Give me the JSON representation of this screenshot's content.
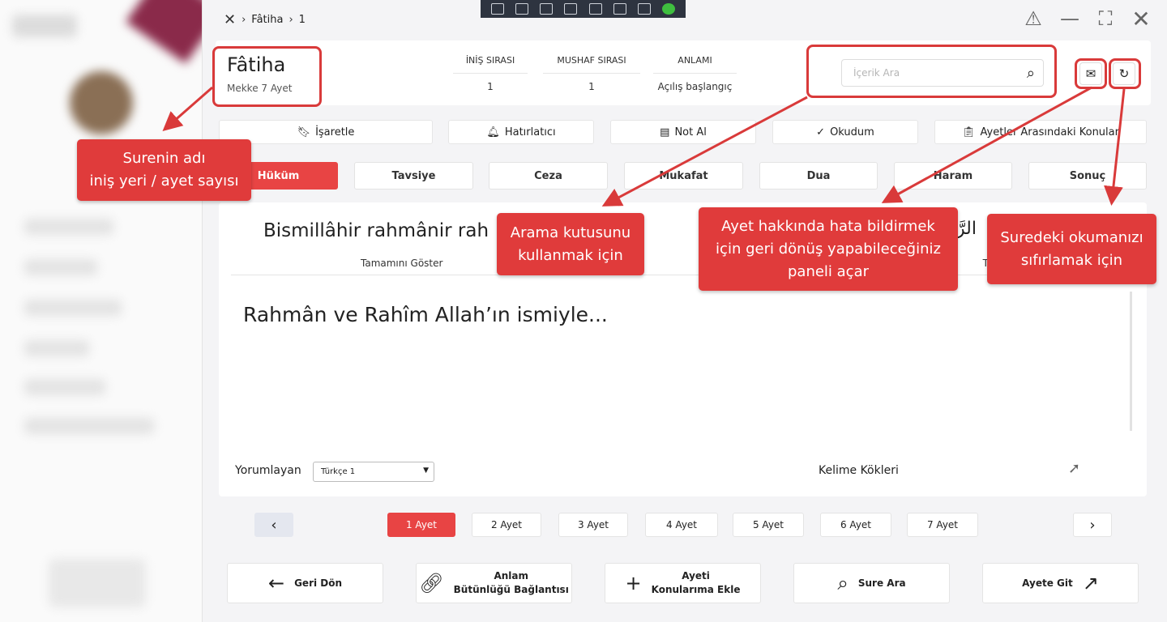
{
  "breadcrumb": {
    "items": [
      "Fâtiha",
      "1"
    ]
  },
  "header": {
    "title": "Fâtiha",
    "place": "Mekke",
    "ayet_count": "7",
    "ayet_label": "Ayet",
    "meta": [
      {
        "label": "İNİŞ SIRASI",
        "value": "1"
      },
      {
        "label": "MUSHAF SIRASI",
        "value": "1"
      },
      {
        "label": "ANLAMI",
        "value": "Açılış başlangıç"
      }
    ],
    "search_placeholder": "İçerik Ara"
  },
  "actions": [
    {
      "label": "İşaretle",
      "icon": "bookmark-icon"
    },
    {
      "label": "Hatırlatıcı",
      "icon": "bell-icon"
    },
    {
      "label": "Not Al",
      "icon": "note-icon"
    },
    {
      "label": "Okudum",
      "icon": "check-icon"
    },
    {
      "label": "Ayetler Arasındaki Konular",
      "icon": "clipboard-icon"
    }
  ],
  "categories": [
    {
      "label": "Hüküm",
      "active": true
    },
    {
      "label": "Tavsiye"
    },
    {
      "label": "Ceza"
    },
    {
      "label": "Mukafat"
    },
    {
      "label": "Dua"
    },
    {
      "label": "Haram"
    },
    {
      "label": "Sonuç"
    }
  ],
  "content": {
    "transliteration": "Bismillâhir rahmânir rah",
    "arabic": "الرَّحِ",
    "show_all": "Tamamını Göster",
    "show_all_right": "T",
    "meaning": "Rahmân ve Rahîm Allah’ın ismiyle...",
    "interpreter_label": "Yorumlayan",
    "interpreter_value": "Türkçe 1",
    "word_roots": "Kelime Kökleri"
  },
  "pager": {
    "pages": [
      "1 Ayet",
      "2 Ayet",
      "3 Ayet",
      "4 Ayet",
      "5 Ayet",
      "6 Ayet",
      "7 Ayet"
    ],
    "active_index": 0
  },
  "bottom_buttons": {
    "back": "Geri Dön",
    "link_line1": "Anlam",
    "link_line2": "Bütünlüğü  Bağlantısı",
    "add_line1": "Ayeti",
    "add_line2": "Konularıma Ekle",
    "search": "Sure Ara",
    "goto": "Ayete Git"
  },
  "annotations": {
    "sura_info": "Surenin adı iniş yeri / ayet sayısı",
    "sura_info_l1": "Surenin adı",
    "sura_info_l2": "iniş yeri / ayet sayısı",
    "search_l1": "Arama kutusunu",
    "search_l2": "kullanmak için",
    "report_l1": "Ayet hakkında hata bildirmek",
    "report_l2": "için geri dönüş yapabileceğiniz",
    "report_l3": "paneli açar",
    "reset_l1": "Suredeki okumanızı",
    "reset_l2": "sıfırlamak için"
  },
  "colors": {
    "accent": "#e84444",
    "annotation": "#e03b3b"
  }
}
